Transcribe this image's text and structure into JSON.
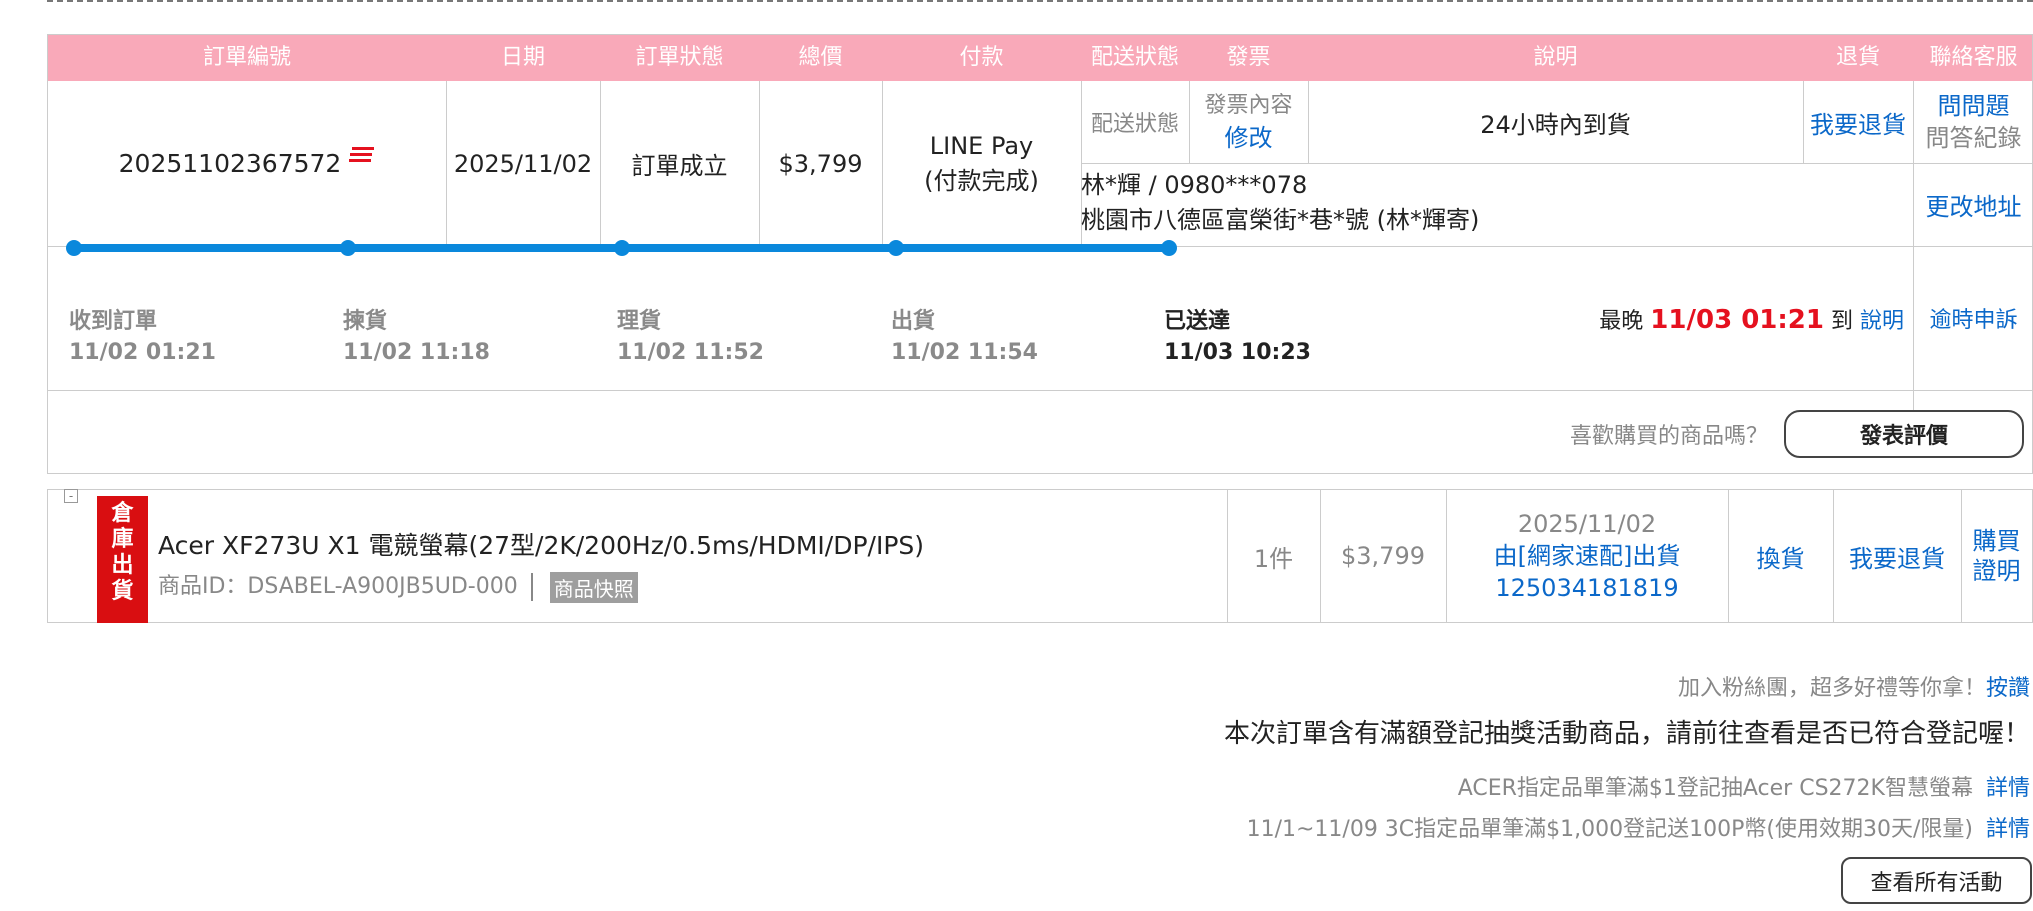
{
  "headers": {
    "order_no": "訂單編號",
    "date": "日期",
    "status": "訂單狀態",
    "total": "總價",
    "payment": "付款",
    "shipping": "配送狀態",
    "invoice": "發票",
    "desc": "說明",
    "return": "退貨",
    "service": "聯絡客服"
  },
  "order": {
    "number": "20251102367572",
    "date": "2025/11/02",
    "status": "訂單成立",
    "total": "$3,799",
    "payment_method": "LINE Pay",
    "payment_status": "(付款完成)",
    "shipping_status_label": "配送狀態",
    "invoice_label": "發票內容",
    "invoice_edit": "修改",
    "description": "24小時內到貨",
    "return_link": "我要退貨",
    "ask_question": "問問題",
    "qa_record": "問答紀錄",
    "recipient": "林*輝 / 0980***078",
    "address": "桃園市八德區富榮街*巷*號 (林*輝寄)",
    "change_address": "更改地址"
  },
  "progress": {
    "steps": [
      {
        "label": "收到訂單",
        "time": "11/02 01:21"
      },
      {
        "label": "揀貨",
        "time": "11/02 11:18"
      },
      {
        "label": "理貨",
        "time": "11/02 11:52"
      },
      {
        "label": "出貨",
        "time": "11/02 11:54"
      },
      {
        "label": "已送達",
        "time": "11/03 10:23"
      }
    ],
    "latest_prefix": "最晚",
    "latest_time": "11/03 01:21",
    "latest_suffix": "到",
    "latest_explain": "說明",
    "overdue": "逾時申訴"
  },
  "review": {
    "prompt": "喜歡購買的商品嗎？",
    "button": "發表評價"
  },
  "product": {
    "tag": "倉庫出貨",
    "tag_chars": [
      "倉",
      "庫",
      "出",
      "貨"
    ],
    "expander": "-",
    "name": "Acer XF273U X1 電競螢幕(27型/2K/200Hz/0.5ms/HDMI/DP/IPS)",
    "id_label": "商品ID：DSABEL-A900JB5UD-000",
    "snapshot": "商品快照",
    "qty": "1件",
    "price": "$3,799",
    "ship_date": "2025/11/02",
    "ship_by": "由[網家速配]出貨",
    "tracking": "125034181819",
    "exchange": "換貨",
    "return": "我要退貨",
    "proof_1": "購買",
    "proof_2": "證明"
  },
  "footer": {
    "fan_text": "加入粉絲團，超多好禮等你拿！",
    "fan_link": "按讚",
    "notice": "本次訂單含有滿額登記抽獎活動商品，請前往查看是否已符合登記喔！",
    "campaigns": [
      {
        "text": "ACER指定品單筆滿$1登記抽Acer CS272K智慧螢幕",
        "link": "詳情"
      },
      {
        "text": "11/1~11/09 3C指定品單筆滿$1,000登記送100P幣(使用效期30天/限量)",
        "link": "詳情"
      }
    ],
    "view_all": "查看所有活動"
  },
  "colors": {
    "header_bg": "#f9a9b9",
    "link": "#0b68c9",
    "progress": "#0a88dc",
    "warehouse_tag": "#d90e11",
    "deadline": "#e5111f"
  }
}
